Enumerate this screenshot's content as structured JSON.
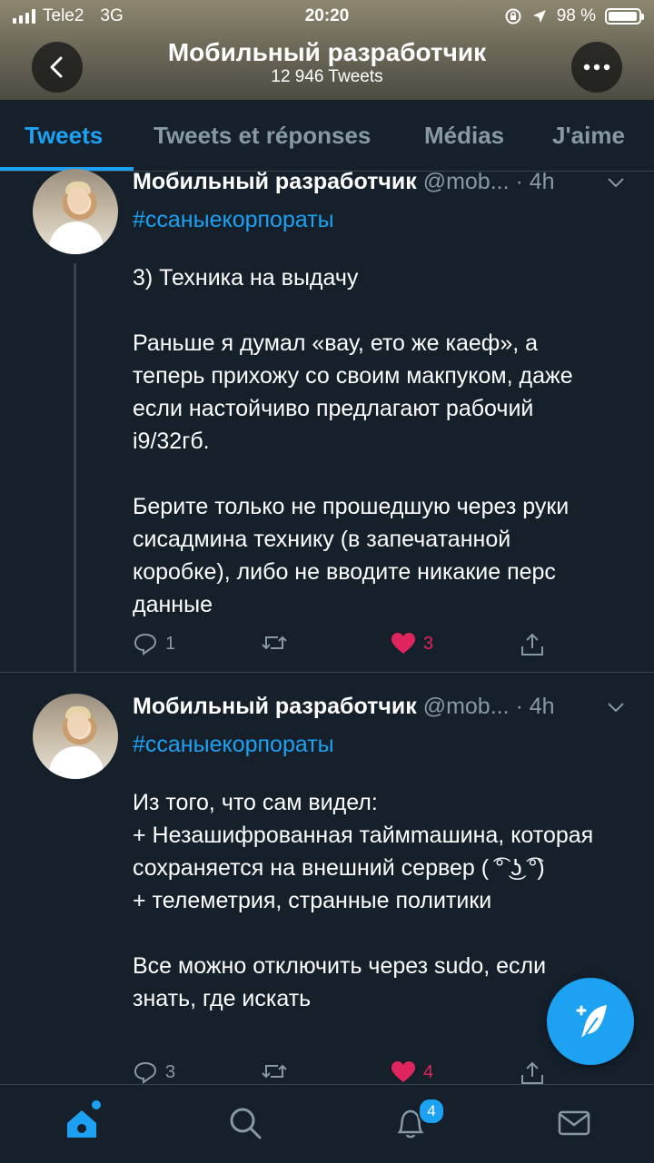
{
  "status_bar": {
    "carrier": "Tele2",
    "network": "3G",
    "time": "20:20",
    "battery_percent": "98 %",
    "battery_level": 0.98
  },
  "header": {
    "title": "Мобильный разработчик",
    "subtitle": "12 946 Tweets"
  },
  "tabs": [
    {
      "label": "Tweets",
      "active": true
    },
    {
      "label": "Tweets et réponses",
      "active": false
    },
    {
      "label": "Médias",
      "active": false
    },
    {
      "label": "J'aime",
      "active": false
    }
  ],
  "tweets": [
    {
      "name": "Мобильный разработчик",
      "handle": "@mob...",
      "time": "· 4h",
      "hashtag": "#ссаныекорпораты",
      "text": "3) Техника на выдачу\n\nРаньше я думал «вау, ето же каеф», а теперь прихожу со своим макпуком, даже если настойчиво предлагают рабочий i9/32гб.\n\nБерите только не прошедшую через руки сисадмина технику (в запечатанной коробке), либо не вводите никакие перс данные",
      "replies": "1",
      "retweets": "",
      "likes": "3"
    },
    {
      "name": "Мобильный разработчик",
      "handle": "@mob...",
      "time": "· 4h",
      "hashtag": "#ссаныекорпораты",
      "text": "Из того, что сам видел:\n+ Незашифрованная таймmашина, которая сохраняется на внешний сервер ( ͡° ͜ʖ ͡°)\n+ телеметрия, странные политики\n\nВсе можно отключить через sudo, если знать, где искать",
      "replies": "3",
      "retweets": "",
      "likes": "4"
    }
  ],
  "bottom_nav": {
    "notifications_badge": "4"
  },
  "colors": {
    "background": "#15202b",
    "accent": "#1da1f2",
    "like": "#e0245e",
    "muted": "#8899a6"
  }
}
